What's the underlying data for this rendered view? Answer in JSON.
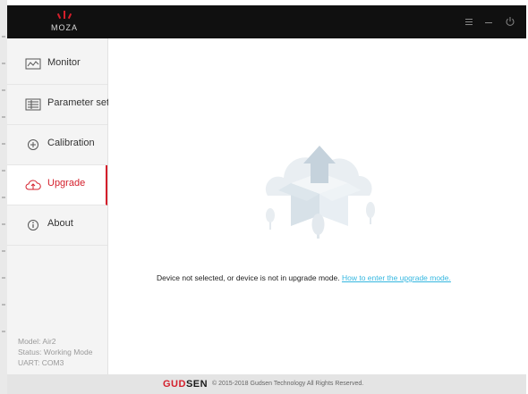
{
  "app": {
    "logo_text": "MOZA",
    "brand": "#d41f2b"
  },
  "window_controls": [
    {
      "name": "menu-icon"
    },
    {
      "name": "minimize-icon"
    },
    {
      "name": "power-icon"
    }
  ],
  "sidebar": {
    "items": [
      {
        "label": "Monitor",
        "icon": "monitor-icon",
        "active": false
      },
      {
        "label": "Parameter set",
        "icon": "parameter-icon",
        "active": false
      },
      {
        "label": "Calibration",
        "icon": "calibration-icon",
        "active": false
      },
      {
        "label": "Upgrade",
        "icon": "cloud-upload-icon",
        "active": true
      },
      {
        "label": "About",
        "icon": "info-icon",
        "active": false
      }
    ],
    "device_info": {
      "model": "Model: Air2",
      "status": "Status: Working Mode",
      "uart": "UART: COM3"
    }
  },
  "main": {
    "illustration": "box-upload-illustration",
    "message": "Device not selected, or device is not in upgrade mode.",
    "link": "How to enter the upgrade mode."
  },
  "footer": {
    "brand_part1": "GUD",
    "brand_part2": "SEN",
    "copyright": "© 2015-2018 Gudsen Technology All Rights Reserved."
  }
}
